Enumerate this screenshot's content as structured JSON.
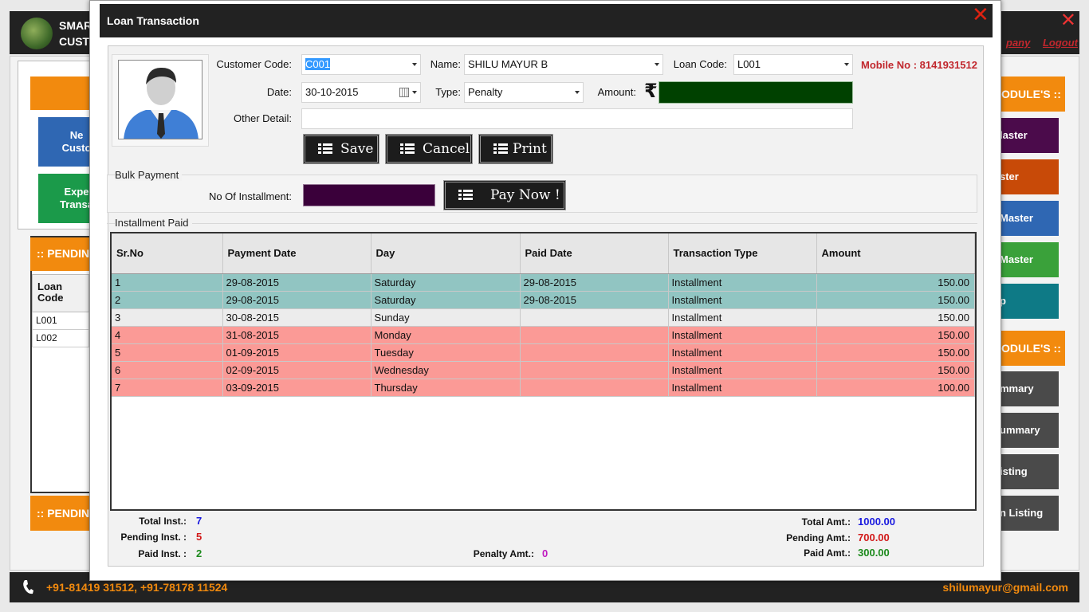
{
  "app": {
    "title_line1": "SMAR",
    "title_line2": "CUST",
    "links": [
      "pany",
      "Logout"
    ],
    "left_header": "",
    "tiles_left": [
      "Ne\nCusto",
      "Expe\nTransa"
    ],
    "pending_header1": ":: PENDIN",
    "pending_header2": ":: PENDIN",
    "pending_table": {
      "header": "Loan\nCode",
      "rows": [
        "L001",
        "L002"
      ]
    },
    "right_header1": "ODULE'S ::",
    "right_header2": "ODULE'S ::",
    "right_tiles_top": [
      {
        "label": "laster",
        "color": "#4b0b4b"
      },
      {
        "label": "ster",
        "color": "#c84a08"
      },
      {
        "label": "Master",
        "color": "#2f67b3"
      },
      {
        "label": "Master",
        "color": "#3aa13a"
      },
      {
        "label": "p",
        "color": "#0e7a86"
      }
    ],
    "right_tiles_bottom": [
      "mmary",
      "ummary",
      "isting",
      "n Listing"
    ],
    "footer_phone": "+91-81419 31512, +91-78178 11524",
    "footer_email": "shilumayur@gmail.com"
  },
  "dialog": {
    "title": "Loan Transaction",
    "form": {
      "customer_code_label": "Customer Code:",
      "customer_code": "C001",
      "name_label": "Name:",
      "name": "SHILU MAYUR B",
      "loan_code_label": "Loan Code:",
      "loan_code": "L001",
      "mobile": "Mobile No : 8141931512",
      "date_label": "Date:",
      "date": "30-10-2015",
      "type_label": "Type:",
      "type": "Penalty",
      "amount_label": "Amount:",
      "rupee": "₹",
      "other_detail_label": "Other Detail:",
      "other_detail": ""
    },
    "buttons": {
      "save": "Save",
      "cancel": "Cancel",
      "print": "Print",
      "pay_now": "Pay Now !"
    },
    "bulk": {
      "title": "Bulk Payment",
      "installment_label": "No Of Installment:",
      "installment_value": ""
    },
    "installments": {
      "title": "Installment Paid",
      "columns": [
        "Sr.No",
        "Payment Date",
        "Day",
        "Paid Date",
        "Transaction Type",
        "Amount"
      ],
      "rows": [
        {
          "sr": "1",
          "payment_date": "29-08-2015",
          "day": "Saturday",
          "paid_date": "29-08-2015",
          "type": "Installment",
          "amount": "150.00",
          "status": "paid"
        },
        {
          "sr": "2",
          "payment_date": "29-08-2015",
          "day": "Saturday",
          "paid_date": "29-08-2015",
          "type": "Installment",
          "amount": "150.00",
          "status": "paid"
        },
        {
          "sr": "3",
          "payment_date": "30-08-2015",
          "day": "Sunday",
          "paid_date": "",
          "type": "Installment",
          "amount": "150.00",
          "status": "pending"
        },
        {
          "sr": "4",
          "payment_date": "31-08-2015",
          "day": "Monday",
          "paid_date": "",
          "type": "Installment",
          "amount": "150.00",
          "status": "overdue"
        },
        {
          "sr": "5",
          "payment_date": "01-09-2015",
          "day": "Tuesday",
          "paid_date": "",
          "type": "Installment",
          "amount": "150.00",
          "status": "overdue"
        },
        {
          "sr": "6",
          "payment_date": "02-09-2015",
          "day": "Wednesday",
          "paid_date": "",
          "type": "Installment",
          "amount": "150.00",
          "status": "overdue"
        },
        {
          "sr": "7",
          "payment_date": "03-09-2015",
          "day": "Thursday",
          "paid_date": "",
          "type": "Installment",
          "amount": "100.00",
          "status": "overdue"
        }
      ]
    },
    "summary": {
      "total_inst_label": "Total Inst.:",
      "total_inst": "7",
      "pending_inst_label": "Pending Inst. :",
      "pending_inst": "5",
      "paid_inst_label": "Paid Inst. :",
      "paid_inst": "2",
      "penalty_label": "Penalty Amt.:",
      "penalty": "0",
      "total_amt_label": "Total Amt.:",
      "total_amt": "1000.00",
      "pending_amt_label": "Pending Amt.:",
      "pending_amt": "700.00",
      "paid_amt_label": "Paid Amt.:",
      "paid_amt": "300.00"
    },
    "colors": {
      "paid_row": "#91c5c2",
      "pending_row": "#ececec",
      "overdue_row": "#fb9a96",
      "mobile": "#c1272d"
    }
  }
}
